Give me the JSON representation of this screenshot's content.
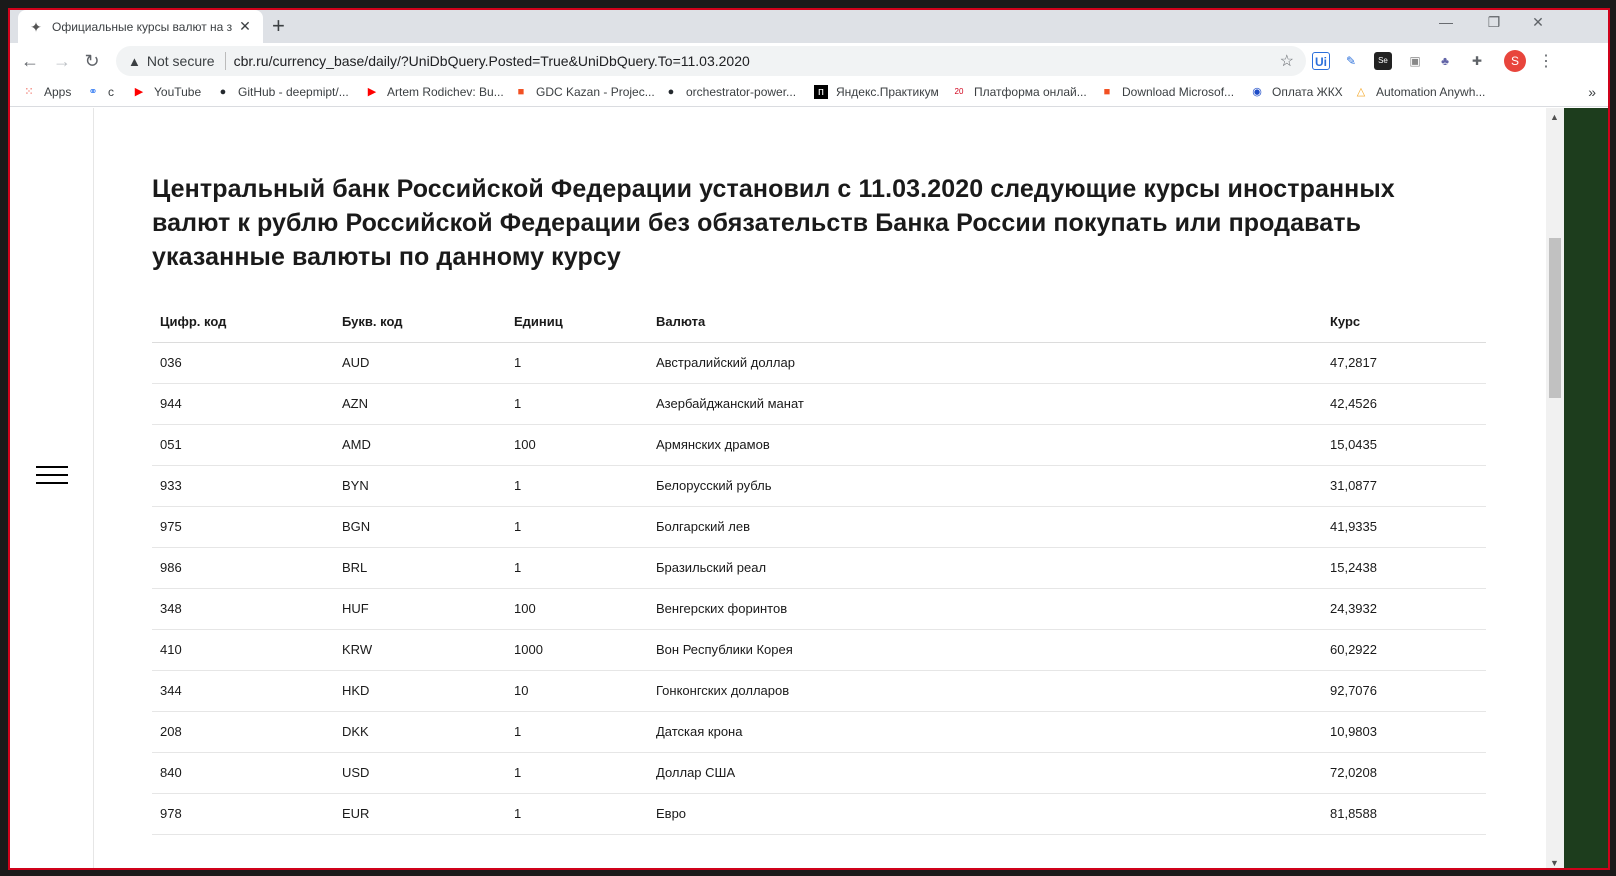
{
  "browser": {
    "tab_title": "Официальные курсы валют на з",
    "url_security": "Not secure",
    "url": "cbr.ru/currency_base/daily/?UniDbQuery.Posted=True&UniDbQuery.To=11.03.2020",
    "avatar_letter": "S",
    "bookmarks": [
      {
        "label": "Apps",
        "icon": "apps-grid-icon",
        "color": "#ea4335"
      },
      {
        "label": "c",
        "icon": "nodes-icon",
        "color": "#4285f4"
      },
      {
        "label": "YouTube",
        "icon": "youtube-icon",
        "color": "#ff0000"
      },
      {
        "label": "GitHub - deepmipt/...",
        "icon": "github-icon",
        "color": "#24292e"
      },
      {
        "label": "Artem Rodichev: Bu...",
        "icon": "youtube-icon",
        "color": "#ff0000"
      },
      {
        "label": "GDC Kazan - Projec...",
        "icon": "windows-icon",
        "color": "#f25022"
      },
      {
        "label": "orchestrator-power...",
        "icon": "github-icon",
        "color": "#24292e"
      },
      {
        "label": "Яндекс.Практикум",
        "icon": "practicum-icon",
        "color": "#000000"
      },
      {
        "label": "Платформа онлай...",
        "icon": "2035-icon",
        "color": "#d0021b"
      },
      {
        "label": "Download Microsof...",
        "icon": "windows-icon",
        "color": "#f25022"
      },
      {
        "label": "Оплата ЖКХ",
        "icon": "ball-icon",
        "color": "#1e4cc7"
      },
      {
        "label": "Automation Anywh...",
        "icon": "automation-icon",
        "color": "#f5a623"
      }
    ]
  },
  "page": {
    "heading": "Центральный банк Российской Федерации установил с 11.03.2020 следующие курсы иностранных валют к рублю Российской Федерации без обязательств Банка России покупать или продавать указанные валюты по данному курсу",
    "table": {
      "headers": [
        "Цифр. код",
        "Букв. код",
        "Единиц",
        "Валюта",
        "Курс"
      ],
      "rows": [
        [
          "036",
          "AUD",
          "1",
          "Австралийский доллар",
          "47,2817"
        ],
        [
          "944",
          "AZN",
          "1",
          "Азербайджанский манат",
          "42,4526"
        ],
        [
          "051",
          "AMD",
          "100",
          "Армянских драмов",
          "15,0435"
        ],
        [
          "933",
          "BYN",
          "1",
          "Белорусский рубль",
          "31,0877"
        ],
        [
          "975",
          "BGN",
          "1",
          "Болгарский лев",
          "41,9335"
        ],
        [
          "986",
          "BRL",
          "1",
          "Бразильский реал",
          "15,2438"
        ],
        [
          "348",
          "HUF",
          "100",
          "Венгерских форинтов",
          "24,3932"
        ],
        [
          "410",
          "KRW",
          "1000",
          "Вон Республики Корея",
          "60,2922"
        ],
        [
          "344",
          "HKD",
          "10",
          "Гонконгских долларов",
          "92,7076"
        ],
        [
          "208",
          "DKK",
          "1",
          "Датская крона",
          "10,9803"
        ],
        [
          "840",
          "USD",
          "1",
          "Доллар США",
          "72,0208"
        ],
        [
          "978",
          "EUR",
          "1",
          "Евро",
          "81,8588"
        ]
      ]
    }
  }
}
